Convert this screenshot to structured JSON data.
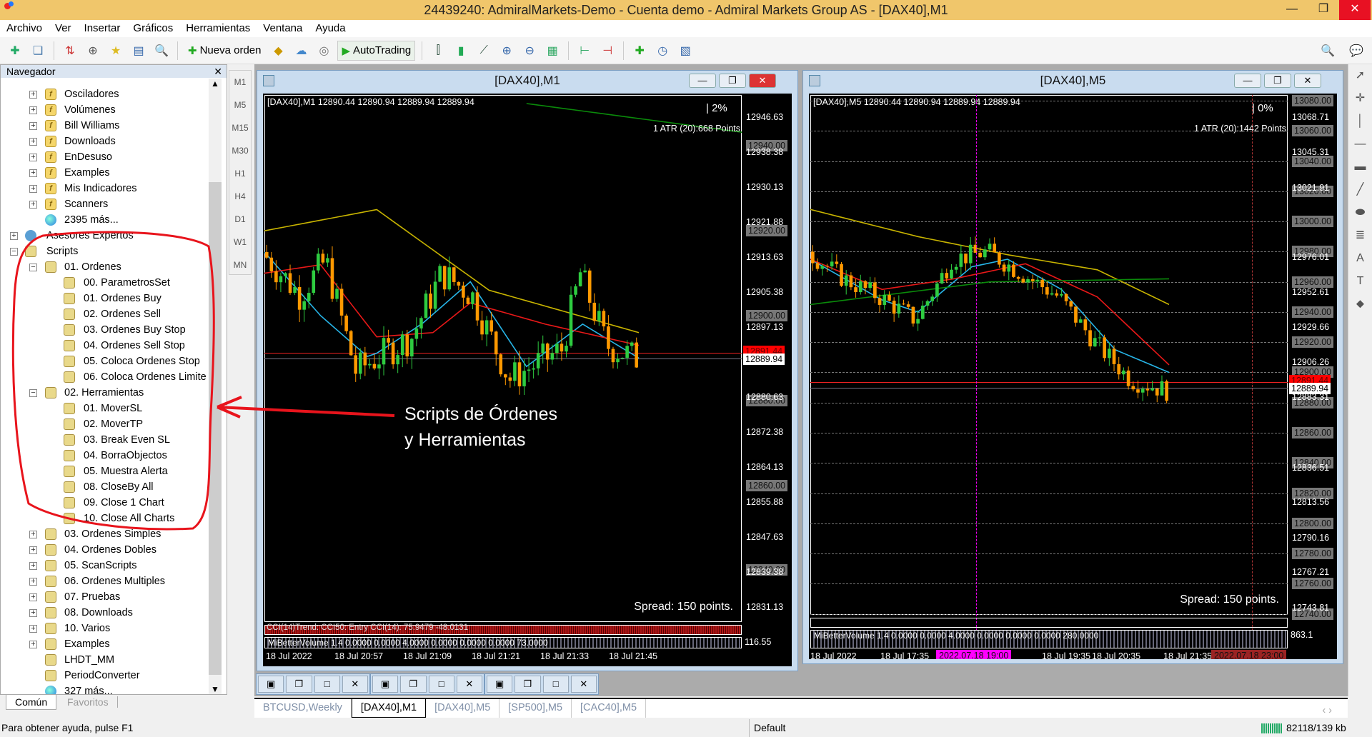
{
  "window": {
    "title": "24439240: AdmiralMarkets-Demo - Cuenta demo - Admiral Markets Group AS - [DAX40],M1"
  },
  "menu": [
    "Archivo",
    "Ver",
    "Insertar",
    "Gráficos",
    "Herramientas",
    "Ventana",
    "Ayuda"
  ],
  "toolbar": {
    "new_order": "Nueva orden",
    "autotrading": "AutoTrading"
  },
  "navigator": {
    "title": "Navegador",
    "items": [
      {
        "label": "Osciladores",
        "lvl": 2,
        "exp": "+",
        "icon": "f"
      },
      {
        "label": "Volúmenes",
        "lvl": 2,
        "exp": "+",
        "icon": "f"
      },
      {
        "label": "Bill Williams",
        "lvl": 2,
        "exp": "+",
        "icon": "f"
      },
      {
        "label": "Downloads",
        "lvl": 2,
        "exp": "+",
        "icon": "f"
      },
      {
        "label": "EnDesuso",
        "lvl": 2,
        "exp": "+",
        "icon": "f"
      },
      {
        "label": "Examples",
        "lvl": 2,
        "exp": "+",
        "icon": "f"
      },
      {
        "label": "Mis Indicadores",
        "lvl": 2,
        "exp": "+",
        "icon": "f"
      },
      {
        "label": "Scanners",
        "lvl": 2,
        "exp": "+",
        "icon": "f"
      },
      {
        "label": "2395 más...",
        "lvl": 2,
        "exp": "",
        "icon": "g"
      },
      {
        "label": "Asesores Expertos",
        "lvl": 1,
        "exp": "+",
        "icon": "e"
      },
      {
        "label": "Scripts",
        "lvl": 1,
        "exp": "−",
        "icon": "s"
      },
      {
        "label": "01. Ordenes",
        "lvl": 2,
        "exp": "−",
        "icon": "s"
      },
      {
        "label": "00. ParametrosSet",
        "lvl": 3,
        "exp": "",
        "icon": "s"
      },
      {
        "label": "01. Ordenes Buy",
        "lvl": 3,
        "exp": "",
        "icon": "s"
      },
      {
        "label": "02. Ordenes Sell",
        "lvl": 3,
        "exp": "",
        "icon": "s"
      },
      {
        "label": "03. Ordenes Buy Stop",
        "lvl": 3,
        "exp": "",
        "icon": "s"
      },
      {
        "label": "04. Ordenes Sell Stop",
        "lvl": 3,
        "exp": "",
        "icon": "s"
      },
      {
        "label": "05. Coloca Ordenes Stop",
        "lvl": 3,
        "exp": "",
        "icon": "s"
      },
      {
        "label": "06. Coloca Ordenes Limite",
        "lvl": 3,
        "exp": "",
        "icon": "s"
      },
      {
        "label": "02. Herramientas",
        "lvl": 2,
        "exp": "−",
        "icon": "s"
      },
      {
        "label": "01. MoverSL",
        "lvl": 3,
        "exp": "",
        "icon": "s"
      },
      {
        "label": "02. MoverTP",
        "lvl": 3,
        "exp": "",
        "icon": "s"
      },
      {
        "label": "03. Break Even SL",
        "lvl": 3,
        "exp": "",
        "icon": "s"
      },
      {
        "label": "04. BorraObjectos",
        "lvl": 3,
        "exp": "",
        "icon": "s"
      },
      {
        "label": "05. Muestra Alerta",
        "lvl": 3,
        "exp": "",
        "icon": "s"
      },
      {
        "label": "08. CloseBy All",
        "lvl": 3,
        "exp": "",
        "icon": "s"
      },
      {
        "label": "09. Close 1 Chart",
        "lvl": 3,
        "exp": "",
        "icon": "s"
      },
      {
        "label": "10. Close All Charts",
        "lvl": 3,
        "exp": "",
        "icon": "s"
      },
      {
        "label": "03. Ordenes Simples",
        "lvl": 2,
        "exp": "+",
        "icon": "s"
      },
      {
        "label": "04. Ordenes Dobles",
        "lvl": 2,
        "exp": "+",
        "icon": "s"
      },
      {
        "label": "05. ScanScripts",
        "lvl": 2,
        "exp": "+",
        "icon": "s"
      },
      {
        "label": "06. Ordenes Multiples",
        "lvl": 2,
        "exp": "+",
        "icon": "s"
      },
      {
        "label": "07. Pruebas",
        "lvl": 2,
        "exp": "+",
        "icon": "s"
      },
      {
        "label": "08. Downloads",
        "lvl": 2,
        "exp": "+",
        "icon": "s"
      },
      {
        "label": "10. Varios",
        "lvl": 2,
        "exp": "+",
        "icon": "s"
      },
      {
        "label": "Examples",
        "lvl": 2,
        "exp": "+",
        "icon": "s"
      },
      {
        "label": "LHDT_MM",
        "lvl": 2,
        "exp": "",
        "icon": "s"
      },
      {
        "label": "PeriodConverter",
        "lvl": 2,
        "exp": "",
        "icon": "s"
      },
      {
        "label": "327 más...",
        "lvl": 2,
        "exp": "",
        "icon": "g"
      }
    ],
    "tabs": [
      "Común",
      "Favoritos"
    ]
  },
  "timeframes": [
    "M1",
    "M5",
    "M15",
    "M30",
    "H1",
    "H4",
    "D1",
    "W1",
    "MN"
  ],
  "annotation": {
    "line1": "Scripts de Órdenes",
    "line2": "y Herramientas",
    "color": "#e8141c"
  },
  "charts": [
    {
      "title": "[DAX40],M1",
      "info": "[DAX40],M1  12890.44 12890.94 12889.94 12889.94",
      "pct": "|  2%",
      "atr": "1 ATR (20):668 Points",
      "spread": "Spread: 150 points.",
      "axis_labels": [
        "12946.63",
        "12938.38",
        "12930.13",
        "12921.88",
        "12913.63",
        "12905.38",
        "12897.13",
        "12888.88",
        "12880.63",
        "12872.38",
        "12864.13",
        "12855.88",
        "12847.63",
        "12839.38",
        "12831.13"
      ],
      "grid_labels": [
        "12940.00",
        "12920.00",
        "12900.00",
        "12880.00",
        "12860.00",
        "12840.00"
      ],
      "bid": "12889.94",
      "ask": "12891.44",
      "ind1": "CCI(14)Trend: CCI50: Entry CCI(14): 75.9479 -48.0131",
      "ind2": "MiBetterVolume 1.4 0.0000 0.0000 4.0000 0.0000 0.0000 0.0000 73.0000",
      "ind2_val": "116.55",
      "times": [
        "18 Jul 2022",
        "18 Jul 20:57",
        "18 Jul 21:09",
        "18 Jul 21:21",
        "18 Jul 21:33",
        "18 Jul 21:45"
      ]
    },
    {
      "title": "[DAX40],M5",
      "info": "[DAX40],M5  12890.44 12890.94 12889.94 12889.94",
      "pct": "|  0%",
      "atr": "1 ATR (20):1442 Points",
      "spread": "Spread: 150 points.",
      "axis_labels": [
        "13068.71",
        "13045.31",
        "13021.91",
        "12976.01",
        "12952.61",
        "12929.66",
        "12906.26",
        "12883.31",
        "12836.51",
        "12813.56",
        "12790.16",
        "12767.21",
        "12743.81"
      ],
      "grid_labels": [
        "13080.00",
        "13060.00",
        "13040.00",
        "13020.00",
        "13000.00",
        "12980.00",
        "12960.00",
        "12940.00",
        "12920.00",
        "12900.00",
        "12880.00",
        "12860.00",
        "12840.00",
        "12820.00",
        "12800.00",
        "12780.00",
        "12760.00",
        "12740.00"
      ],
      "bid": "12889.94",
      "ask": "12891.44",
      "ind2": "MiBetterVolume 1.4 0.0000 0.0000 4.0000 0.0000 0.0000 0.0000 280.0000",
      "ind2_val": "863.1",
      "times": [
        "18 Jul 2022",
        "18 Jul 17:35",
        "18 Jul 19:35",
        "18 Jul 20:35",
        "18 Jul 21:35"
      ],
      "marker1": "2022.07.18 19:00",
      "marker2": "2022.07.18 23:00"
    }
  ],
  "chart_tabs": [
    "BTCUSD,Weekly",
    "[DAX40],M1",
    "[DAX40],M5",
    "[SP500],M5",
    "[CAC40],M5"
  ],
  "active_tab": 1,
  "status": {
    "help": "Para obtener ayuda, pulse F1",
    "profile": "Default",
    "traffic": "82118/139 kb"
  }
}
